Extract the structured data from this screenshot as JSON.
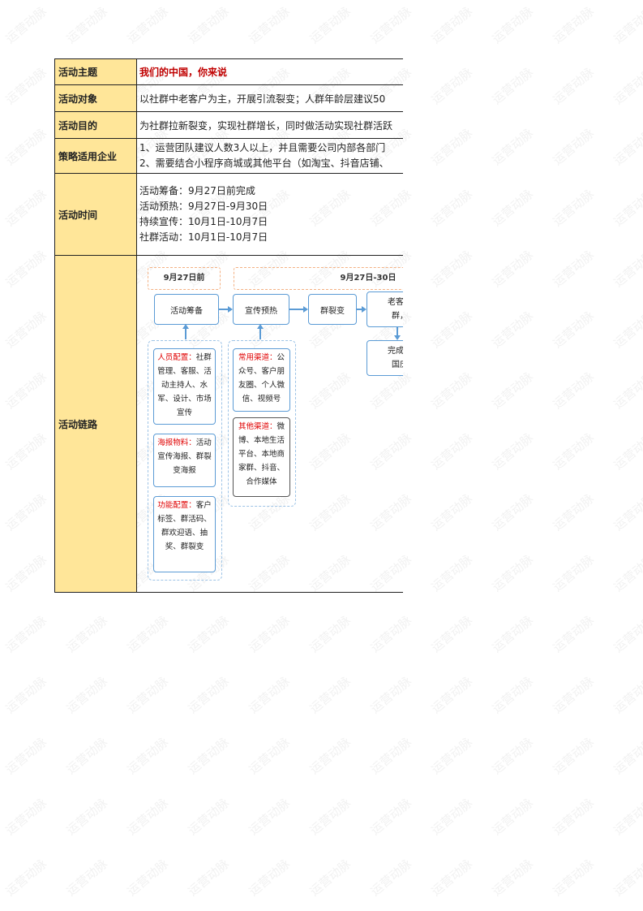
{
  "watermark": "运营动脉",
  "rows": {
    "theme": {
      "label": "活动主题",
      "value": "我们的中国，你来说"
    },
    "audience": {
      "label": "活动对象",
      "value": "以社群中老客户为主，开展引流裂变；人群年龄层建议50"
    },
    "purpose": {
      "label": "活动目的",
      "value": "为社群拉新裂变，实现社群增长，同时做活动实现社群活跃"
    },
    "strategy": {
      "label": "策略适用企业",
      "lines": [
        "1、运营团队建议人数3人以上，并且需要公司内部各部门",
        "2、需要结合小程序商城或其他平台（如淘宝、抖音店铺、"
      ]
    },
    "time": {
      "label": "活动时间",
      "lines": [
        "活动筹备：9月27日前完成",
        "活动预热：9月27日-9月30日",
        "持续宣传：10月1日-10月7日",
        "社群活动：10月1日-10月7日"
      ]
    },
    "chain": {
      "label": "活动链路"
    }
  },
  "flow": {
    "phase1": "9月27日前",
    "phase2": "9月27日-30日",
    "node_prepare": "活动筹备",
    "node_warmup": "宣传预热",
    "node_fission": "群裂变",
    "node_invite_1": "老客邀请",
    "node_invite_2": "群，完",
    "node_complete_1": "完成任务",
    "node_complete_2": "国庆礼",
    "card_staff": {
      "tag": "人员配置：",
      "text": "社群管理、客服、活动主持人、水军、设计、市场宣传"
    },
    "card_poster": {
      "tag": "海报物料：",
      "text": "活动宣传海报、群裂变海报"
    },
    "card_feature": {
      "tag": "功能配置：",
      "text": "客户标签、群活码、群欢迎语、抽奖、群裂变"
    },
    "card_common": {
      "tag": "常用渠道：",
      "text": "公众号、客户朋友圈、个人微信、视频号"
    },
    "card_other": {
      "tag": "其他渠道：",
      "text": "微博、本地生活平台、本地商家群、抖音、合作媒体"
    }
  },
  "colors": {
    "label_bg": "#ffe699",
    "accent_red": "#c00000",
    "flow_blue": "#5b9bd5",
    "phase_orange": "#f4b183"
  }
}
